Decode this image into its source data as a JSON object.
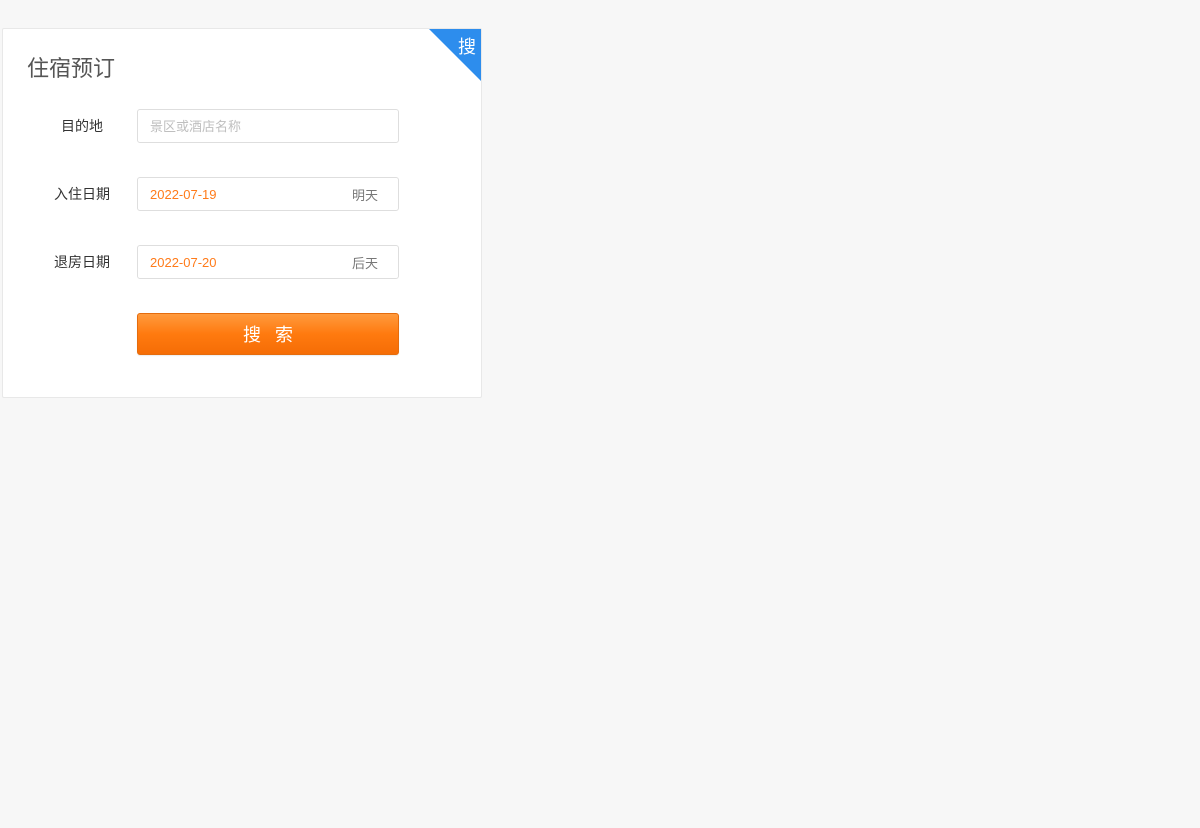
{
  "card": {
    "title": "住宿预订",
    "corner_badge": "搜"
  },
  "form": {
    "destination": {
      "label": "目的地",
      "placeholder": "景区或酒店名称",
      "value": ""
    },
    "checkin": {
      "label": "入住日期",
      "value": "2022-07-19",
      "hint": "明天"
    },
    "checkout": {
      "label": "退房日期",
      "value": "2022-07-20",
      "hint": "后天"
    },
    "search_button_label": "搜索"
  }
}
